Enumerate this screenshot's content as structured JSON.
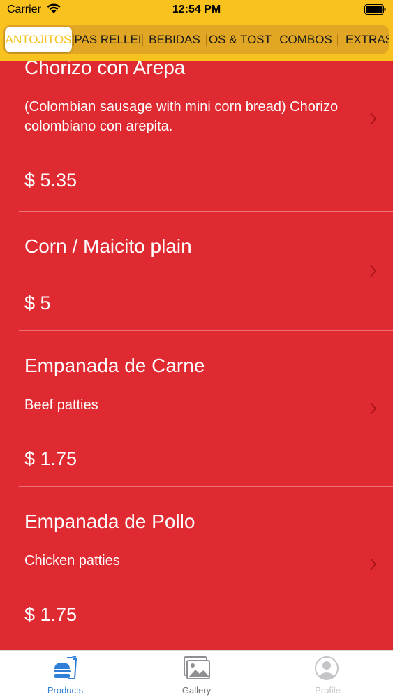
{
  "status_bar": {
    "carrier": "Carrier",
    "time": "12:54 PM"
  },
  "categories": [
    {
      "label": "ANTOJITOS",
      "active": true
    },
    {
      "label": "PAS RELLEI",
      "active": false
    },
    {
      "label": "BEBIDAS",
      "active": false
    },
    {
      "label": "OS & TOST",
      "active": false
    },
    {
      "label": "COMBOS",
      "active": false
    },
    {
      "label": "EXTRAS",
      "active": false
    }
  ],
  "products": [
    {
      "name": "Chorizo con Arepa",
      "description": "(Colombian sausage with mini corn bread) Chorizo colombiano con arepita.",
      "price": "$ 5.35"
    },
    {
      "name": "Corn / Maicito plain",
      "description": "",
      "price": "$ 5"
    },
    {
      "name": "Empanada de Carne",
      "description": "Beef patties",
      "price": "$ 1.75"
    },
    {
      "name": "Empanada de Pollo",
      "description": "Chicken patties",
      "price": "$ 1.75"
    }
  ],
  "tab_bar": {
    "products_label": "Products",
    "gallery_label": "Gallery",
    "profile_label": "Profile"
  },
  "colors": {
    "header": "#F9C21E",
    "list_background": "#E02A31",
    "active_tab": "#2F7ED8",
    "inactive_tab": "#8E8E93"
  }
}
